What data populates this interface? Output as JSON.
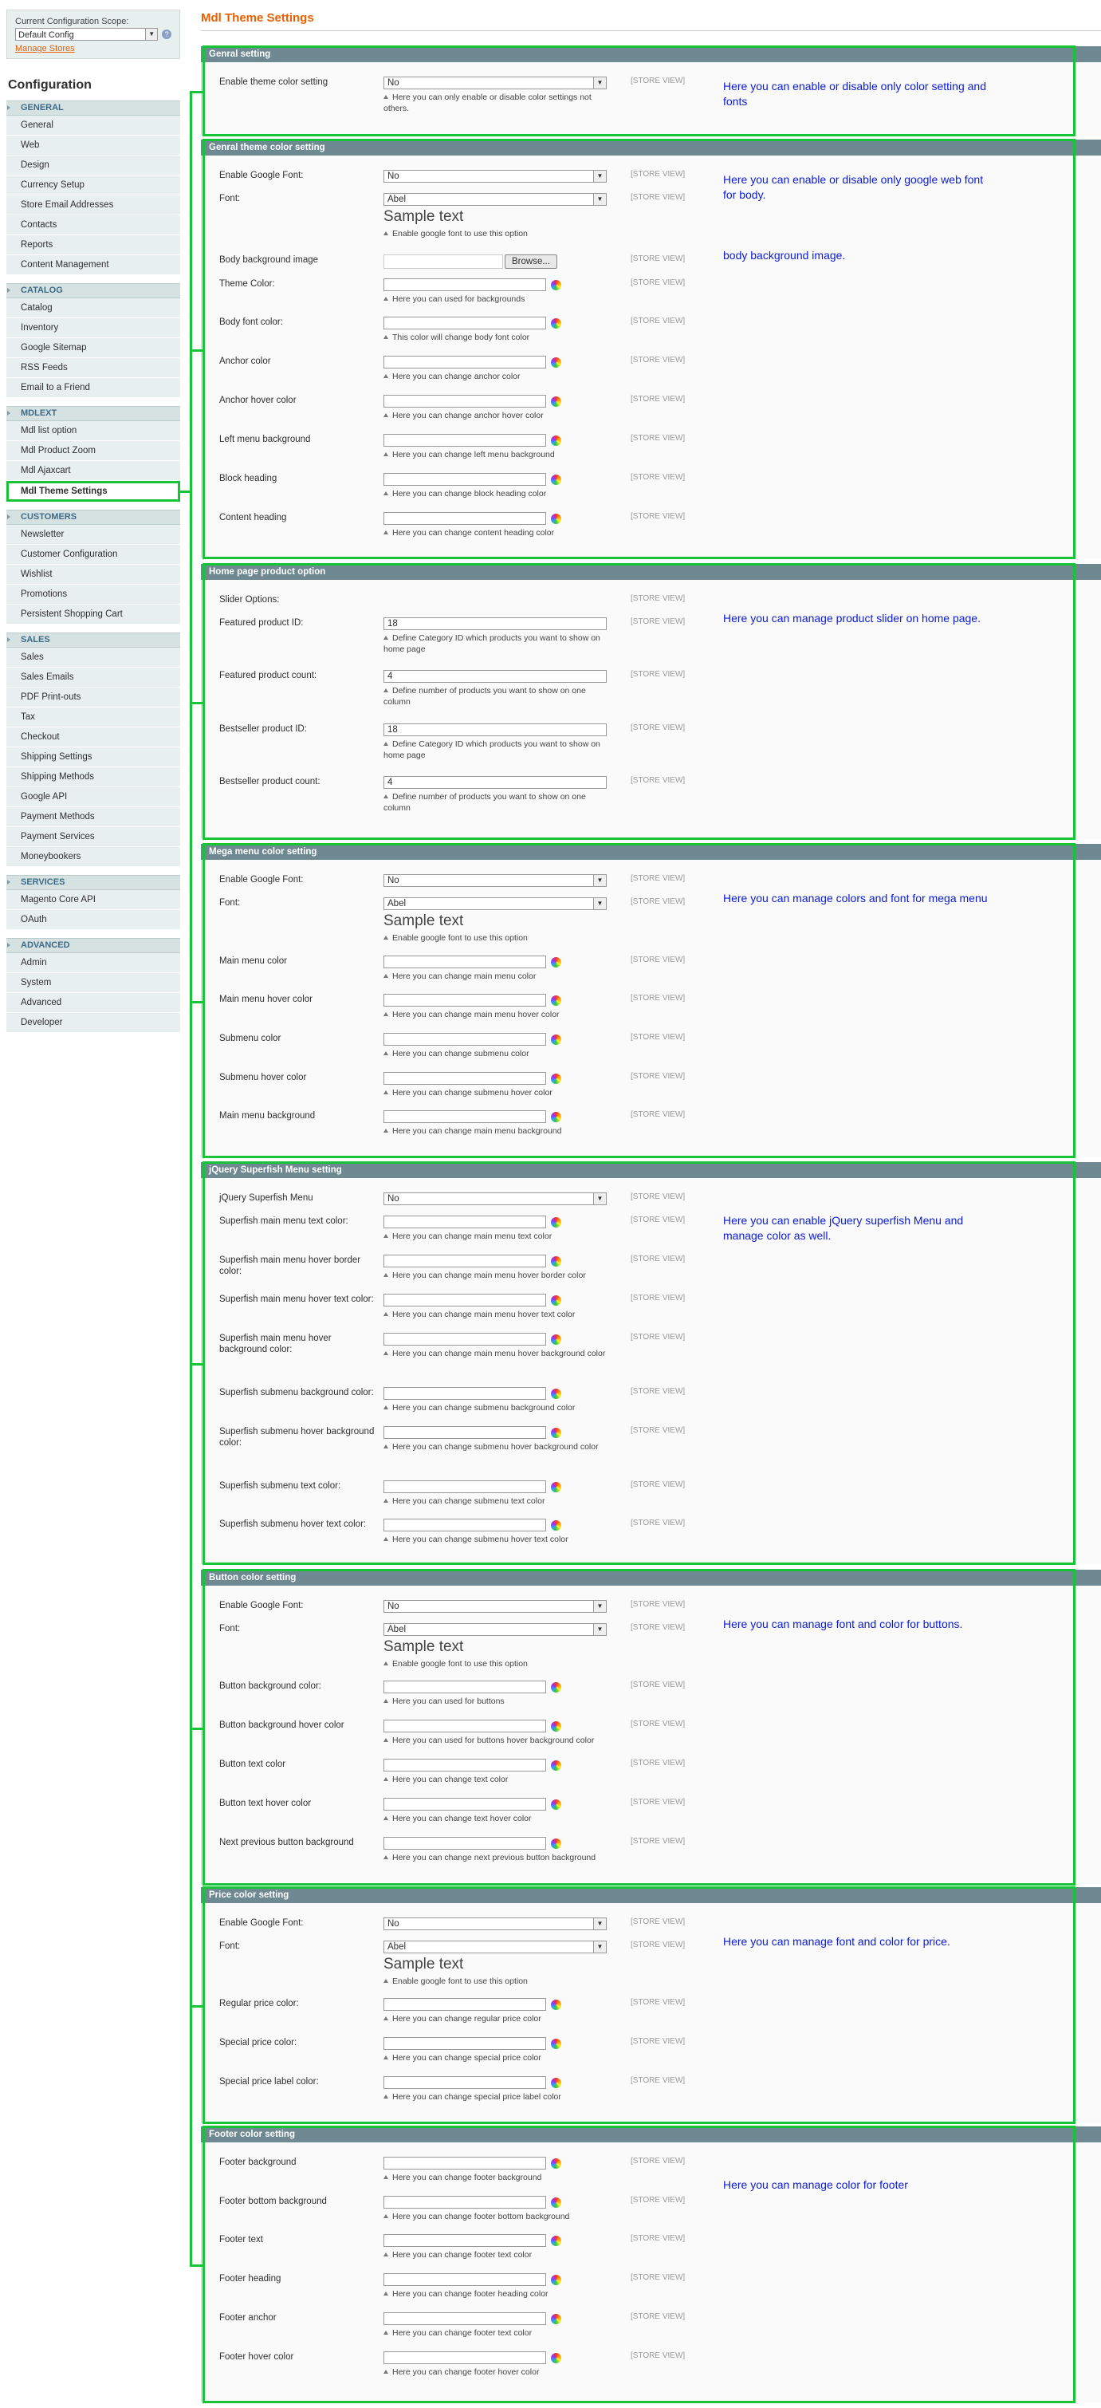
{
  "scope": {
    "label": "Current Configuration Scope:",
    "value": "Default Config",
    "manage_link": "Manage Stores"
  },
  "sidebar": {
    "heading": "Configuration",
    "groups": [
      {
        "name": "GENERAL",
        "items": [
          "General",
          "Web",
          "Design",
          "Currency Setup",
          "Store Email Addresses",
          "Contacts",
          "Reports",
          "Content Management"
        ]
      },
      {
        "name": "CATALOG",
        "items": [
          "Catalog",
          "Inventory",
          "Google Sitemap",
          "RSS Feeds",
          "Email to a Friend"
        ]
      },
      {
        "name": "MDLEXT",
        "items": [
          "Mdl list option",
          "Mdl Product Zoom",
          "Mdl Ajaxcart",
          "Mdl Theme Settings"
        ]
      },
      {
        "name": "CUSTOMERS",
        "items": [
          "Newsletter",
          "Customer Configuration",
          "Wishlist",
          "Promotions",
          "Persistent Shopping Cart"
        ]
      },
      {
        "name": "SALES",
        "items": [
          "Sales",
          "Sales Emails",
          "PDF Print-outs",
          "Tax",
          "Checkout",
          "Shipping Settings",
          "Shipping Methods",
          "Google API",
          "Payment Methods",
          "Payment Services",
          "Moneybookers"
        ]
      },
      {
        "name": "SERVICES",
        "items": [
          "Magento Core API",
          "OAuth"
        ]
      },
      {
        "name": "ADVANCED",
        "items": [
          "Admin",
          "System",
          "Advanced",
          "Developer"
        ]
      }
    ]
  },
  "page": {
    "title": "Mdl Theme Settings",
    "scope_tag": "[STORE VIEW]",
    "sample_text": "Sample text",
    "browse_label": "Browse..."
  },
  "sections": [
    {
      "title": "Genral setting",
      "annotation": "Here you can enable or disable only color setting and fonts",
      "rows": [
        {
          "label": "Enable theme color setting",
          "type": "select",
          "value": "No",
          "note": "Here you can only enable or disable color settings not others."
        }
      ]
    },
    {
      "title": "Genral theme color setting",
      "annotation": "Here you can enable or disable only google web font for body.",
      "annotation2": "body background image.",
      "rows": [
        {
          "label": "Enable Google Font:",
          "type": "select",
          "value": "No",
          "note": ""
        },
        {
          "label": "Font:",
          "type": "select",
          "value": "Abel",
          "note": "Enable google font to use this option"
        },
        {
          "label": "Body background image",
          "type": "file",
          "value": "",
          "note": ""
        },
        {
          "label": "Theme Color:",
          "type": "color",
          "value": "",
          "note": "Here you can used for backgrounds"
        },
        {
          "label": "Body font color:",
          "type": "color",
          "value": "",
          "note": "This color will change body font color"
        },
        {
          "label": "Anchor color",
          "type": "color",
          "value": "",
          "note": "Here you can change anchor color"
        },
        {
          "label": "Anchor hover color",
          "type": "color",
          "value": "",
          "note": "Here you can change anchor hover color"
        },
        {
          "label": "Left menu background",
          "type": "color",
          "value": "",
          "note": "Here you can change left menu background"
        },
        {
          "label": "Block heading",
          "type": "color",
          "value": "",
          "note": "Here you can change block heading color"
        },
        {
          "label": "Content heading",
          "type": "color",
          "value": "",
          "note": "Here you can change content heading color"
        }
      ]
    },
    {
      "title": "Home page product option",
      "annotation": "Here you can manage product slider on home page.",
      "rows": [
        {
          "label": "Slider Options:",
          "type": "none",
          "value": "",
          "note": ""
        },
        {
          "label": "Featured product ID:",
          "type": "text",
          "value": "18",
          "note": "Define Category ID which products you want to show on home page"
        },
        {
          "label": "Featured product count:",
          "type": "text",
          "value": "4",
          "note": "Define number of products you want to show on one column"
        },
        {
          "label": "Bestseller product ID:",
          "type": "text",
          "value": "18",
          "note": "Define Category ID which products you want to show on home page"
        },
        {
          "label": "Bestseller product count:",
          "type": "text",
          "value": "4",
          "note": "Define number of products you want to show on one column"
        }
      ]
    },
    {
      "title": "Mega menu color setting",
      "annotation": "Here you can manage colors and font  for mega menu",
      "rows": [
        {
          "label": "Enable Google Font:",
          "type": "select",
          "value": "No",
          "note": ""
        },
        {
          "label": "Font:",
          "type": "select",
          "value": "Abel",
          "note": "Enable google font to use this option"
        },
        {
          "label": "Main menu color",
          "type": "color",
          "value": "",
          "note": "Here you can change main menu color"
        },
        {
          "label": "Main menu hover color",
          "type": "color",
          "value": "",
          "note": "Here you can change main menu hover color"
        },
        {
          "label": "Submenu color",
          "type": "color",
          "value": "",
          "note": "Here you can change submenu color"
        },
        {
          "label": "Submenu hover color",
          "type": "color",
          "value": "",
          "note": "Here you can change submenu hover color"
        },
        {
          "label": "Main menu background",
          "type": "color",
          "value": "",
          "note": "Here you can change main menu background"
        }
      ]
    },
    {
      "title": "jQuery Superfish Menu setting",
      "annotation": "Here you can enable jQuery superfish Menu and manage color as well.",
      "rows": [
        {
          "label": "jQuery Superfish Menu",
          "type": "select",
          "value": "No",
          "note": ""
        },
        {
          "label": "Superfish main menu text color:",
          "type": "color",
          "value": "",
          "note": "Here you can change main menu text color"
        },
        {
          "label": "Superfish main menu hover border color:",
          "type": "color",
          "value": "",
          "note": "Here you can change main menu hover border color"
        },
        {
          "label": "Superfish main menu hover text color:",
          "type": "color",
          "value": "",
          "note": "Here you can change main menu hover text color"
        },
        {
          "label": "Superfish main menu hover background color:",
          "type": "color",
          "value": "",
          "note": "Here you can change main menu hover background color"
        },
        {
          "label": "Superfish submenu background color:",
          "type": "color",
          "value": "",
          "note": "Here you can change submenu background color"
        },
        {
          "label": "Superfish submenu hover background color:",
          "type": "color",
          "value": "",
          "note": "Here you can change submenu hover background color"
        },
        {
          "label": "Superfish submenu text color:",
          "type": "color",
          "value": "",
          "note": "Here you can change submenu text color"
        },
        {
          "label": "Superfish submenu hover text color:",
          "type": "color",
          "value": "",
          "note": "Here you can change submenu hover text color"
        }
      ]
    },
    {
      "title": "Button color setting",
      "annotation": "Here you can manage font and color for buttons.",
      "rows": [
        {
          "label": "Enable Google Font:",
          "type": "select",
          "value": "No",
          "note": ""
        },
        {
          "label": "Font:",
          "type": "select",
          "value": "Abel",
          "note": "Enable google font to use this option"
        },
        {
          "label": "Button background color:",
          "type": "color",
          "value": "",
          "note": "Here you can used for buttons"
        },
        {
          "label": "Button background hover color",
          "type": "color",
          "value": "",
          "note": "Here you can used for buttons hover background color"
        },
        {
          "label": "Button text color",
          "type": "color",
          "value": "",
          "note": "Here you can change text color"
        },
        {
          "label": "Button text hover color",
          "type": "color",
          "value": "",
          "note": "Here you can change text hover color"
        },
        {
          "label": "Next previous button background",
          "type": "color",
          "value": "",
          "note": "Here you can change next previous button background"
        }
      ]
    },
    {
      "title": "Price color setting",
      "annotation": "Here you can manage font and color for price.",
      "rows": [
        {
          "label": "Enable Google Font:",
          "type": "select",
          "value": "No",
          "note": ""
        },
        {
          "label": "Font:",
          "type": "select",
          "value": "Abel",
          "note": "Enable google font to use this option"
        },
        {
          "label": "Regular price color:",
          "type": "color",
          "value": "",
          "note": "Here you can change regular price color"
        },
        {
          "label": "Special price color:",
          "type": "color",
          "value": "",
          "note": "Here you can change special price color"
        },
        {
          "label": "Special price label color:",
          "type": "color",
          "value": "",
          "note": "Here you can change special price label color"
        }
      ]
    },
    {
      "title": "Footer color setting",
      "annotation": "Here you can manage color for footer",
      "rows": [
        {
          "label": "Footer background",
          "type": "color",
          "value": "",
          "note": "Here you can change footer background"
        },
        {
          "label": "Footer bottom background",
          "type": "color",
          "value": "",
          "note": "Here you can change footer bottom background"
        },
        {
          "label": "Footer text",
          "type": "color",
          "value": "",
          "note": "Here you can change footer text color"
        },
        {
          "label": "Footer heading",
          "type": "color",
          "value": "",
          "note": "Here you can change footer heading color"
        },
        {
          "label": "Footer anchor",
          "type": "color",
          "value": "",
          "note": "Here you can change footer text color"
        },
        {
          "label": "Footer hover color",
          "type": "color",
          "value": "",
          "note": "Here you can change footer hover color"
        }
      ]
    }
  ],
  "colors": {
    "accent_orange": "#eb5e00",
    "section_header": "#6f8992",
    "highlight_green": "#18c437",
    "annotation_blue": "#0a1bd9",
    "nav_bg": "#e7efef",
    "nav_header_text": "#3d6b8a"
  }
}
